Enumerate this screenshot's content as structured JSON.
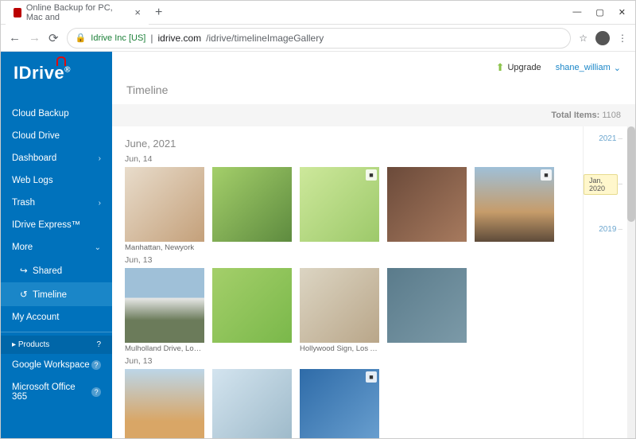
{
  "browser": {
    "tab_title": "Online Backup for PC, Mac and",
    "url_ev": "Idrive Inc [US]",
    "url_domain": "idrive.com",
    "url_path": "/idrive/timelineImageGallery"
  },
  "sidebar": {
    "logo_a": "IDriv",
    "logo_b": "e",
    "items": [
      {
        "label": "Cloud Backup",
        "chev": ""
      },
      {
        "label": "Cloud Drive",
        "chev": ""
      },
      {
        "label": "Dashboard",
        "chev": "›"
      },
      {
        "label": "Web Logs",
        "chev": ""
      },
      {
        "label": "Trash",
        "chev": "›"
      },
      {
        "label": "IDrive Express™",
        "chev": ""
      },
      {
        "label": "More",
        "chev": "⌄"
      }
    ],
    "subitems": [
      {
        "icon": "↪",
        "label": "Shared"
      },
      {
        "icon": "↺",
        "label": "Timeline"
      }
    ],
    "account": "My Account",
    "products_header": "Products",
    "products": [
      {
        "label": "Google Workspace"
      },
      {
        "label": "Microsoft Office 365"
      }
    ]
  },
  "topbar": {
    "upgrade": "Upgrade",
    "user": "shane_william"
  },
  "page": {
    "title": "Timeline",
    "total_label": "Total Items:",
    "total_value": "1108"
  },
  "gallery": {
    "month": "June, 2021",
    "groups": [
      {
        "day": "Jun, 14",
        "items": [
          {
            "cls": "t1",
            "video": false,
            "caption": "Manhattan, Newyork"
          },
          {
            "cls": "t2",
            "video": false,
            "caption": ""
          },
          {
            "cls": "t3",
            "video": true,
            "caption": ""
          },
          {
            "cls": "t4",
            "video": false,
            "caption": ""
          },
          {
            "cls": "t5",
            "video": true,
            "caption": ""
          }
        ]
      },
      {
        "day": "Jun, 13",
        "items": [
          {
            "cls": "t6",
            "video": false,
            "caption": "Mulholland Drive, Los A..."
          },
          {
            "cls": "t7",
            "video": false,
            "caption": ""
          },
          {
            "cls": "t8",
            "video": false,
            "caption": "Hollywood Sign, Los Ang..."
          },
          {
            "cls": "t9",
            "video": false,
            "caption": ""
          }
        ]
      },
      {
        "day": "Jun, 13",
        "items": [
          {
            "cls": "t10",
            "video": false,
            "caption": ""
          },
          {
            "cls": "t11",
            "video": false,
            "caption": ""
          },
          {
            "cls": "t12",
            "video": true,
            "caption": ""
          }
        ]
      }
    ]
  },
  "years": {
    "list": [
      "2021",
      "2020",
      "2019"
    ],
    "tag": "Jan, 2020"
  }
}
